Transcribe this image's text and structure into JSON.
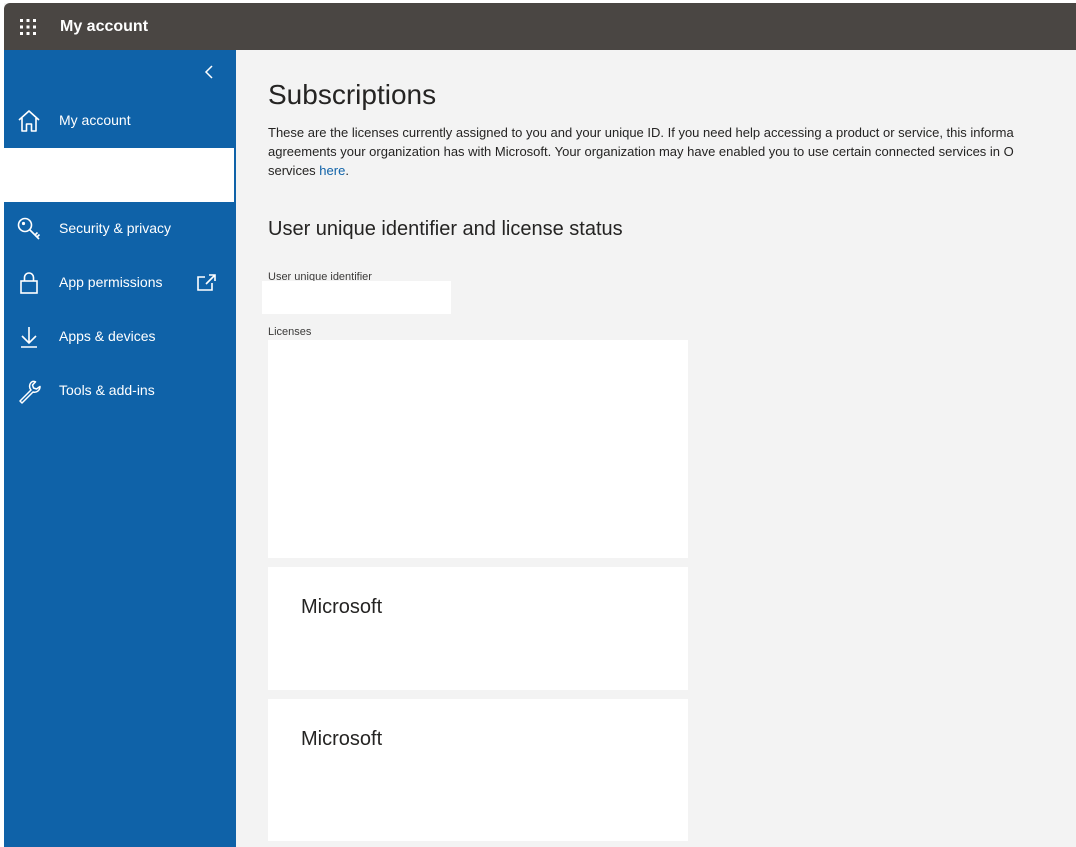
{
  "header": {
    "app_title": "My account",
    "waffle_icon": "waffle-icon"
  },
  "sidebar": {
    "background": "#0f62a8",
    "collapse_icon": "chevron-left-icon",
    "items": [
      {
        "label": "My account",
        "icon": "home-icon"
      },
      {
        "label": "Security & privacy",
        "icon": "key-icon"
      },
      {
        "label": "App permissions",
        "icon": "lock-icon",
        "trailing_icon": "external-link-icon"
      },
      {
        "label": "Apps & devices",
        "icon": "download-icon"
      },
      {
        "label": "Tools & add-ins",
        "icon": "wrench-icon"
      }
    ]
  },
  "main": {
    "title": "Subscriptions",
    "description_lines": [
      "These are the licenses currently assigned to you and your unique ID. If you need help accessing a product or service, this informa",
      "agreements your organization has with Microsoft. Your organization may have enabled you to use certain connected services in O",
      "services "
    ],
    "description_link": "here",
    "description_end": ".",
    "section_title": "User unique identifier and license status",
    "uid_label": "User unique identifier",
    "uid_value": "",
    "licenses_label": "Licenses",
    "license_cards": [
      {
        "title": ""
      },
      {
        "title": "Microsoft"
      },
      {
        "title": "Microsoft"
      }
    ]
  },
  "colors": {
    "topbar": "#4a4643",
    "sidebar": "#0f62a8",
    "content_bg": "#f3f3f3",
    "link": "#0f62a8"
  }
}
